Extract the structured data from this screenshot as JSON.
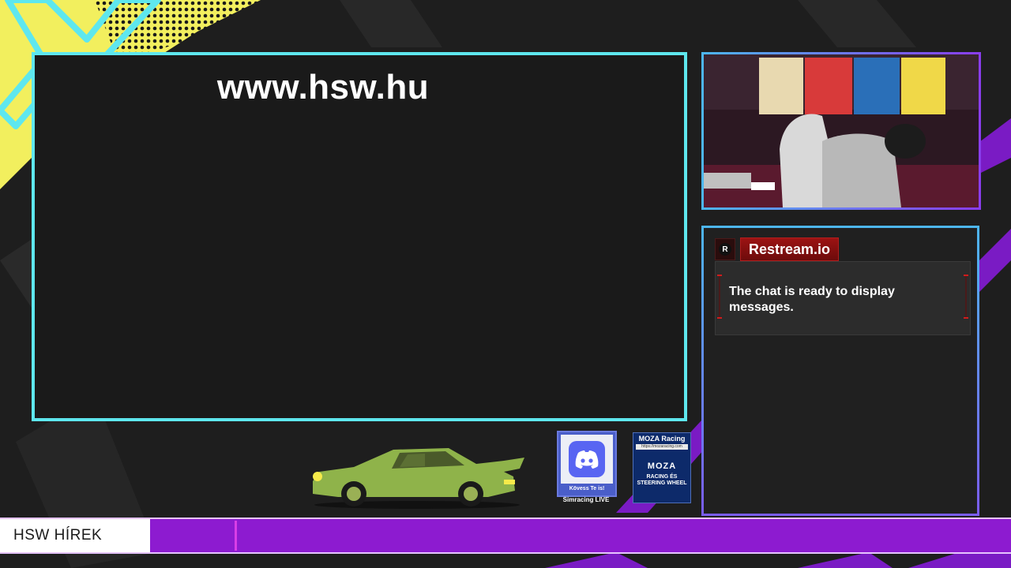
{
  "main_frame": {
    "url_text": "www.hsw.hu"
  },
  "chat": {
    "platform_badge": "R",
    "platform_name": "Restream.io",
    "message": "The chat is ready to display messages."
  },
  "discord": {
    "caption": "Kövess Te is!",
    "subtitle": "Simracing LIVE"
  },
  "moza": {
    "title": "MOZA Racing",
    "url": "https://mozaracing.com",
    "brand": "MOZA",
    "tagline_line1": "RACING ÉS",
    "tagline_line2": "STEERING WHEEL"
  },
  "ticker": {
    "label": "HSW HÍREK"
  },
  "colors": {
    "accent_cyan": "#5ee7ee",
    "accent_purple": "#8d1bd0",
    "accent_yellow": "#f2ef5e",
    "chat_red": "#9c1313"
  }
}
